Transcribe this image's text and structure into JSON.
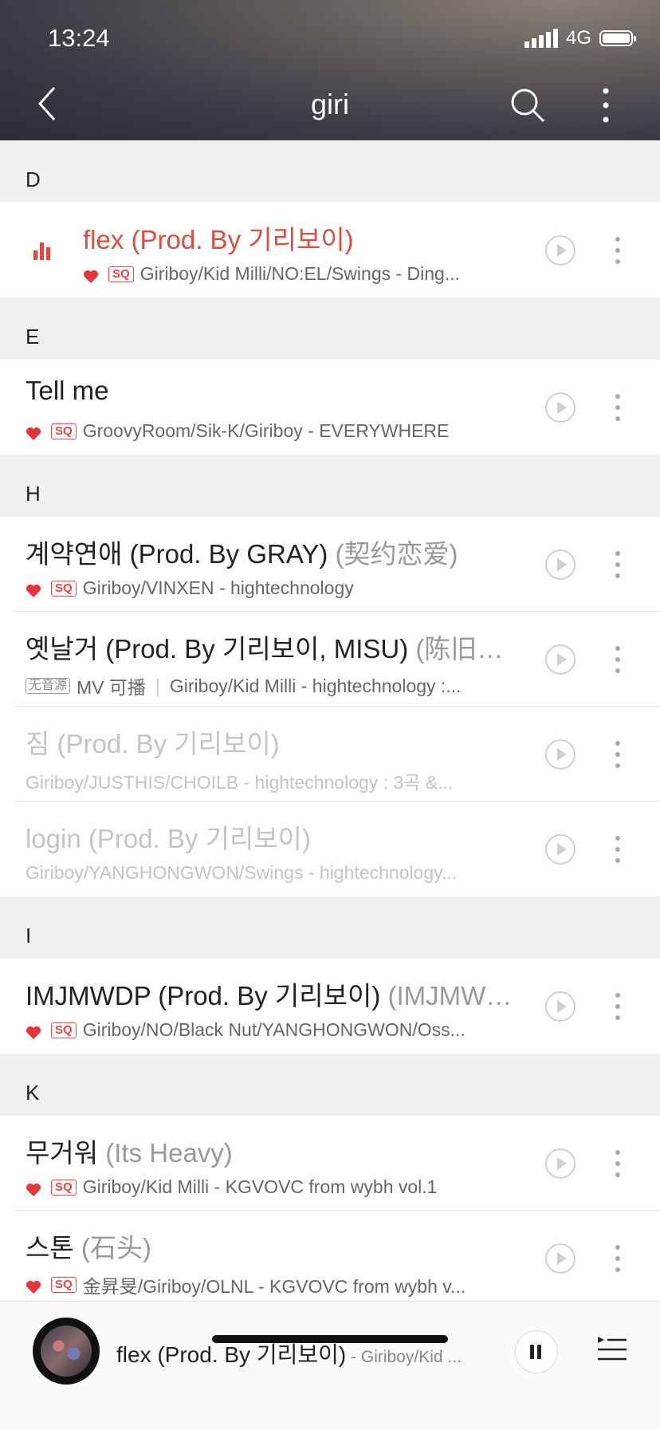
{
  "status_bar": {
    "time": "13:24",
    "network": "4G"
  },
  "header": {
    "title": "giri"
  },
  "sections": [
    {
      "letter": "D",
      "songs": [
        {
          "title": "flex (Prod. By 기리보이)",
          "subtitle": "",
          "badge": "SQ",
          "favorite": true,
          "meta": "Giriboy/Kid Milli/NO:EL/Swings - Ding...",
          "state": "playing"
        }
      ]
    },
    {
      "letter": "E",
      "songs": [
        {
          "title": "Tell me",
          "subtitle": "",
          "badge": "SQ",
          "favorite": true,
          "meta": "GroovyRoom/Sik-K/Giriboy - EVERYWHERE",
          "state": "normal"
        }
      ]
    },
    {
      "letter": "H",
      "songs": [
        {
          "title": "계약연애 (Prod. By GRAY)",
          "subtitle": " (契约恋爱)",
          "badge": "SQ",
          "favorite": true,
          "meta": "Giriboy/VINXEN - hightechnology",
          "state": "normal"
        },
        {
          "title": "옛날거 (Prod. By 기리보이, MISU)",
          "subtitle": " (陈旧…",
          "badge": "无音源",
          "favorite": false,
          "mv": "MV 可播",
          "meta": "Giriboy/Kid Milli - hightechnology :...",
          "state": "normal"
        },
        {
          "title": "짐 (Prod. By 기리보이)",
          "subtitle": "",
          "badge": "",
          "favorite": false,
          "meta": "Giriboy/JUSTHIS/CHOILB - hightechnology : 3곡 &...",
          "state": "disabled"
        },
        {
          "title": "login (Prod. By 기리보이)",
          "subtitle": "",
          "badge": "",
          "favorite": false,
          "meta": "Giriboy/YANGHONGWON/Swings - hightechnology...",
          "state": "disabled"
        }
      ]
    },
    {
      "letter": "I",
      "songs": [
        {
          "title": "IMJMWDP (Prod. By 기리보이)",
          "subtitle": " (IMJMW…",
          "badge": "SQ",
          "favorite": true,
          "meta": "Giriboy/NO/Black Nut/YANGHONGWON/Oss...",
          "state": "normal"
        }
      ]
    },
    {
      "letter": "K",
      "songs": [
        {
          "title": "무거워",
          "subtitle": " (Its Heavy)",
          "badge": "SQ",
          "favorite": true,
          "meta": "Giriboy/Kid Milli - KGVOVC from wybh vol.1",
          "state": "normal"
        },
        {
          "title": "스톤",
          "subtitle": " (石头)",
          "badge": "SQ",
          "favorite": true,
          "meta": "金昇旻/Giriboy/OLNL - KGVOVC from wybh v...",
          "state": "normal"
        }
      ]
    }
  ],
  "now_playing": {
    "title": "flex (Prod. By 기리보이)",
    "artist": " - Giriboy/Kid ..."
  },
  "colors": {
    "accent": "#e04b3f",
    "disabled": "#c4c4c4"
  },
  "icons": {
    "back": "back-arrow-icon",
    "search": "search-icon",
    "more": "more-vertical-icon",
    "play": "play-circle-icon",
    "pause": "pause-icon",
    "playlist": "playlist-icon",
    "heart": "heart-icon",
    "equalizer": "equalizer-icon"
  }
}
